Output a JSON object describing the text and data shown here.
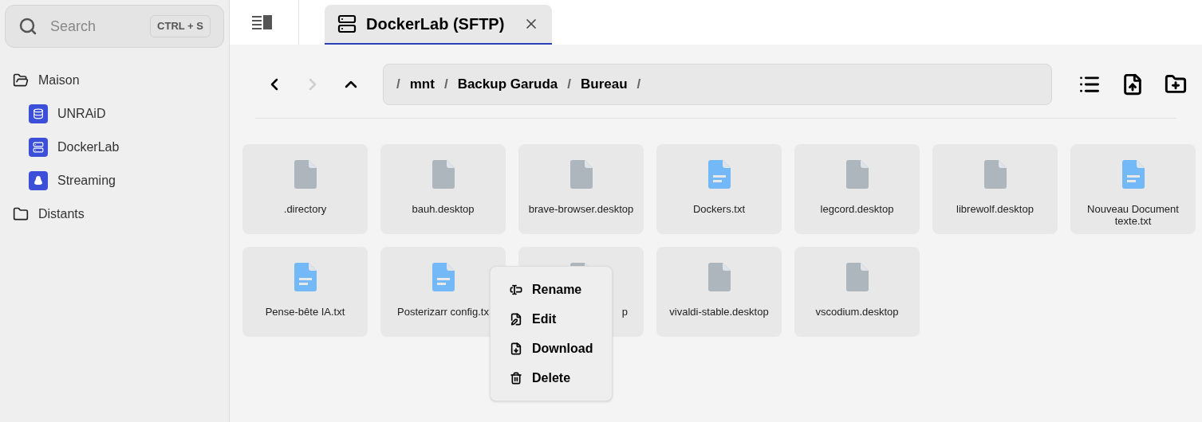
{
  "search": {
    "placeholder": "Search",
    "shortcut": "CTRL + S"
  },
  "sidebar": {
    "items": [
      {
        "label": "Maison",
        "kind": "folder-open",
        "children": [
          {
            "label": "UNRAiD",
            "kind": "database"
          },
          {
            "label": "DockerLab",
            "kind": "server"
          },
          {
            "label": "Streaming",
            "kind": "penguin"
          }
        ]
      },
      {
        "label": "Distants",
        "kind": "folder"
      }
    ]
  },
  "tabs": [
    {
      "label": "DockerLab (SFTP)",
      "selected": true
    }
  ],
  "nav": [
    {
      "kind": "back",
      "disabled": false
    },
    {
      "kind": "forward",
      "disabled": true
    },
    {
      "kind": "up",
      "disabled": false
    }
  ],
  "breadcrumb": {
    "separator": "/",
    "segments": [
      "mnt",
      "Backup Garuda",
      "Bureau"
    ]
  },
  "toolbar": [
    {
      "kind": "list"
    },
    {
      "kind": "upload-file"
    },
    {
      "kind": "new-folder"
    }
  ],
  "files": [
    {
      "name": ".directory",
      "kind": "generic",
      "covered": false
    },
    {
      "name": "bauh.desktop",
      "kind": "generic",
      "covered": false
    },
    {
      "name": "brave-browser.desktop",
      "kind": "generic",
      "covered": false
    },
    {
      "name": "Dockers.txt",
      "kind": "text",
      "covered": false
    },
    {
      "name": "legcord.desktop",
      "kind": "generic",
      "covered": false
    },
    {
      "name": "librewolf.desktop",
      "kind": "generic",
      "covered": false
    },
    {
      "name": "Nouveau Document texte.txt",
      "kind": "text",
      "covered": false
    },
    {
      "name": "Pense-bête IA.txt",
      "kind": "text",
      "covered": false
    },
    {
      "name": "Posterizarr config.tx",
      "kind": "text",
      "covered": false
    },
    {
      "name": "p",
      "kind": "generic",
      "covered": true
    },
    {
      "name": "vivaldi-stable.desktop",
      "kind": "generic",
      "covered": false
    },
    {
      "name": "vscodium.desktop",
      "kind": "generic",
      "covered": false
    }
  ],
  "context_menu": [
    {
      "label": "Rename",
      "kind": "rename"
    },
    {
      "label": "Edit",
      "kind": "edit"
    },
    {
      "label": "Download",
      "kind": "download"
    },
    {
      "label": "Delete",
      "kind": "delete"
    }
  ]
}
